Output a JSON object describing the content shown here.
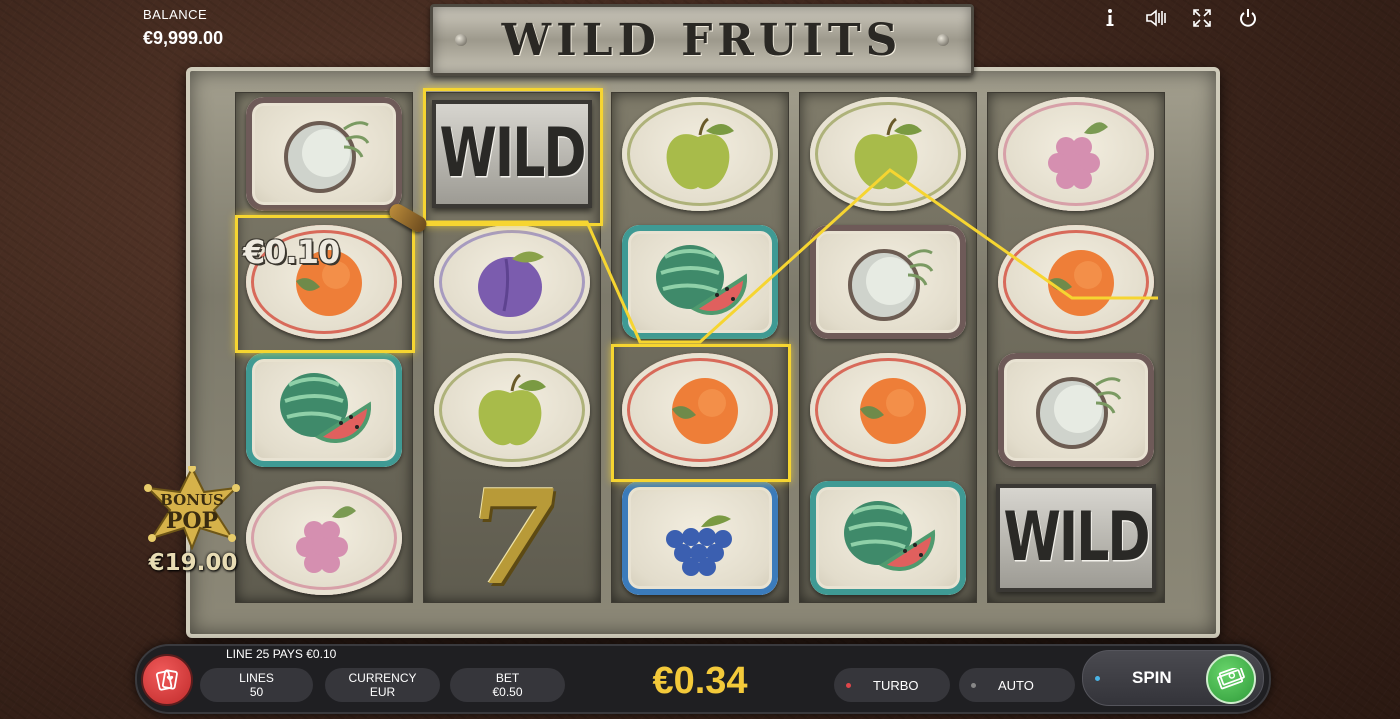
{
  "balance": {
    "label": "BALANCE",
    "value": "€9,999.00"
  },
  "title": "WILD FRUITS",
  "top_icons": [
    "info-icon",
    "sound-icon",
    "fullscreen-icon",
    "power-icon"
  ],
  "reels": [
    [
      "coconut",
      "orange",
      "watermelon",
      "raspberry"
    ],
    [
      "wild",
      "plum",
      "apple",
      "seven"
    ],
    [
      "apple",
      "watermelon",
      "orange",
      "grapes"
    ],
    [
      "apple",
      "coconut",
      "orange",
      "watermelon"
    ],
    [
      "raspberry",
      "orange",
      "coconut",
      "wild"
    ]
  ],
  "wild_label": "WILD",
  "seven_label": "7",
  "win": {
    "amount": "€0.10",
    "line_message": "LINE 25 PAYS €0.10"
  },
  "bonus": {
    "line1": "BONUS",
    "line2": "POP",
    "amount": "€19.00"
  },
  "controls": {
    "lines": {
      "label": "LINES",
      "value": "50"
    },
    "currency": {
      "label": "CURRENCY",
      "value": "EUR"
    },
    "bet": {
      "label": "BET",
      "value": "€0.50"
    },
    "total": "€0.34",
    "turbo": "TURBO",
    "auto": "AUTO",
    "spin": "SPIN"
  },
  "colors": {
    "win_line": "#f6d531",
    "total": "#f3c93a",
    "spin_button": "#3fae48",
    "turbo_dot": "#e0464a",
    "spin_dot": "#4ab4e6"
  }
}
